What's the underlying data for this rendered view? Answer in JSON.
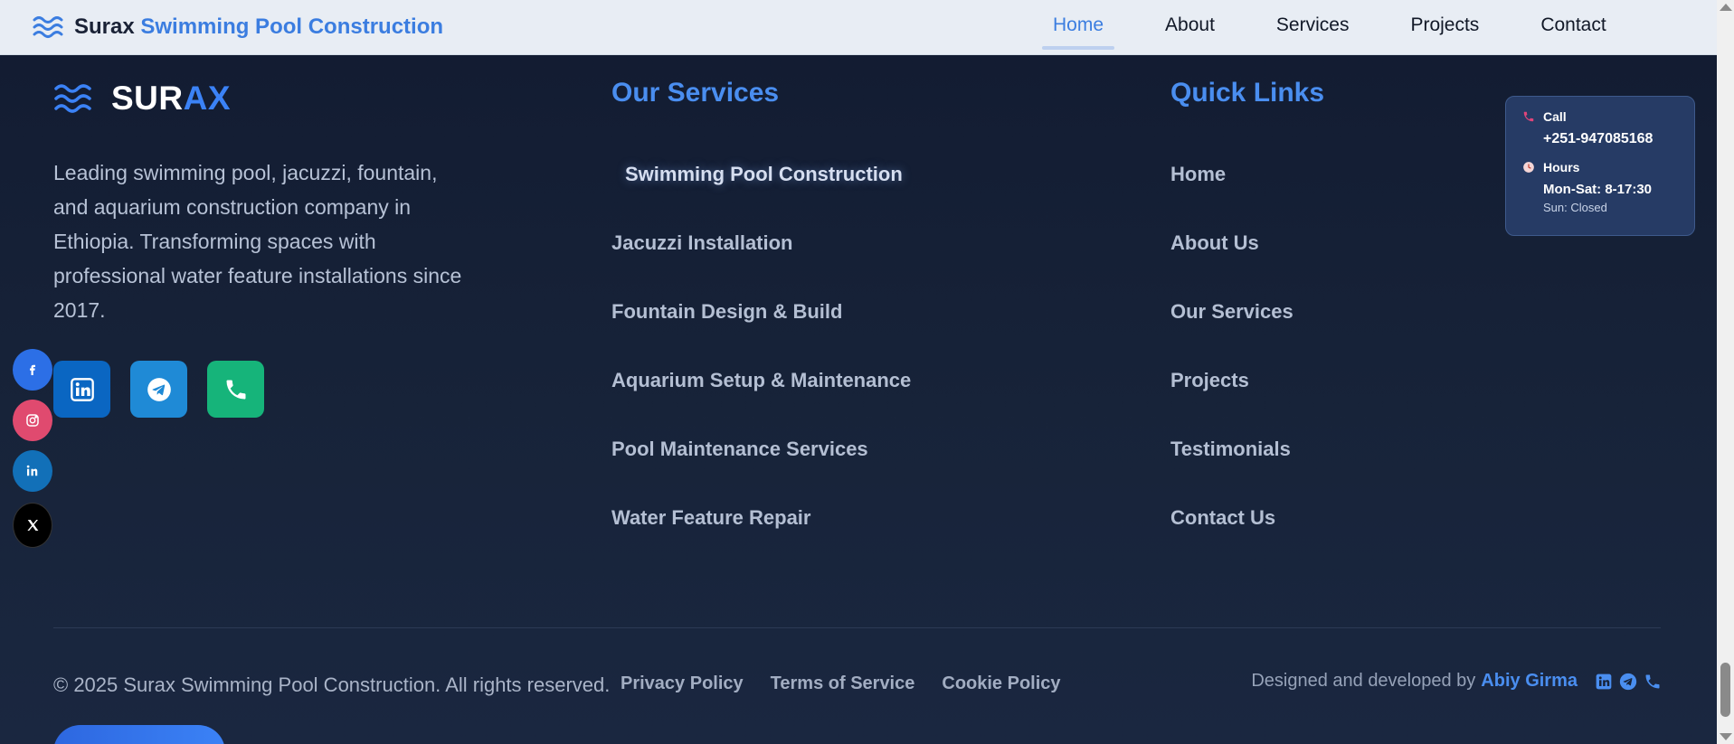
{
  "navbar": {
    "brand_main": "Surax",
    "brand_accent": "Swimming Pool Construction",
    "items": [
      {
        "label": "Home",
        "active": true
      },
      {
        "label": "About"
      },
      {
        "label": "Services"
      },
      {
        "label": "Projects"
      },
      {
        "label": "Contact"
      }
    ]
  },
  "footer": {
    "logo_main": "SUR",
    "logo_accent": "AX",
    "about_text": "Leading swimming pool, jacuzzi, fountain, and aquarium construction company in Ethiopia. Transforming spaces with professional water feature installations since 2017.",
    "social_buttons": [
      "linkedin-icon",
      "telegram-icon",
      "phone-icon"
    ],
    "services_title": "Our Services",
    "services": [
      "Swimming Pool Construction",
      "Jacuzzi Installation",
      "Fountain Design & Build",
      "Aquarium Setup & Maintenance",
      "Pool Maintenance Services",
      "Water Feature Repair"
    ],
    "links_title": "Quick Links",
    "links": [
      "Home",
      "About Us",
      "Our Services",
      "Projects",
      "Testimonials",
      "Contact Us"
    ]
  },
  "contact_card": {
    "call_label": "Call",
    "phone": "+251-947085168",
    "hours_label": "Hours",
    "hours_weekdays": "Mon-Sat: 8-17:30",
    "hours_sunday": "Sun: Closed"
  },
  "floating_social": [
    "facebook-icon",
    "instagram-icon",
    "linkedin-icon",
    "x-icon"
  ],
  "bottom_bar": {
    "copyright": "© 2025 Surax Swimming Pool Construction. All rights reserved.",
    "links": [
      "Privacy Policy",
      "Terms of Service",
      "Cookie Policy"
    ],
    "credit_prefix": "Designed and developed by",
    "credit_author": "Abiy Girma"
  },
  "colors": {
    "accent": "#3b7de0",
    "background": "#141e33",
    "navbar_bg": "#e8edf4"
  }
}
